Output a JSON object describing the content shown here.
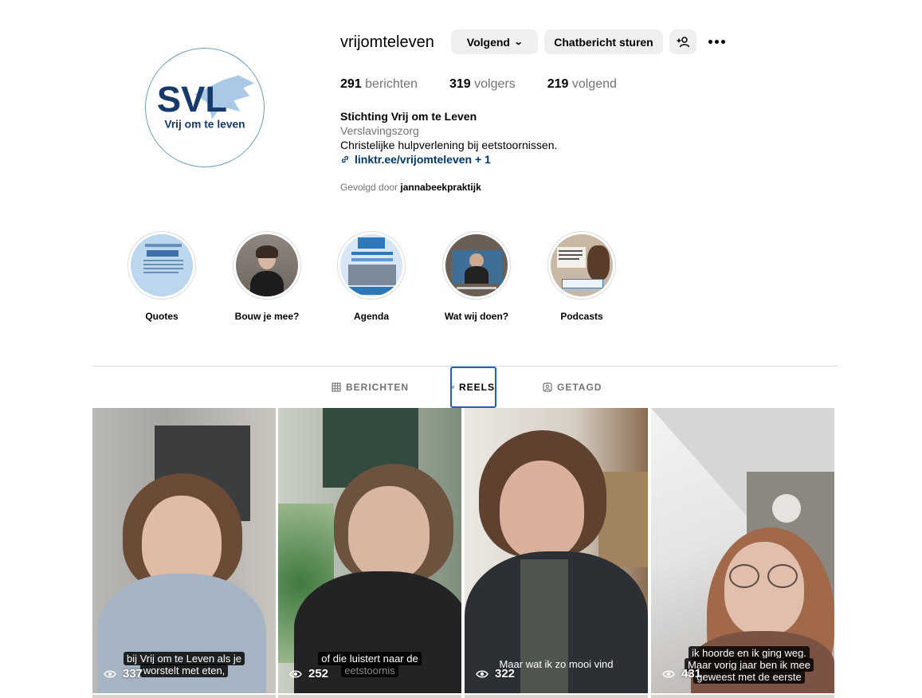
{
  "profile": {
    "username": "vrijomteleven",
    "follow_button": "Volgend",
    "message_button": "Chatbericht sturen",
    "avatar_logo": {
      "letters": "SVL",
      "tagline": "Vrij om te leven"
    },
    "stats": {
      "posts_count": "291",
      "posts_label": "berichten",
      "followers_count": "319",
      "followers_label": "volgers",
      "following_count": "219",
      "following_label": "volgend"
    },
    "bio": {
      "name": "Stichting Vrij om te Leven",
      "category": "Verslavingszorg",
      "text": "Christelijke hulpverlening bij eetstoornissen.",
      "link": "linktr.ee/vrijomteleven + 1"
    },
    "followed_by_prefix": "Gevolgd door",
    "followed_by_user": "jannabeekpraktijk"
  },
  "highlights": [
    {
      "label": "Quotes"
    },
    {
      "label": "Bouw je mee?"
    },
    {
      "label": "Agenda"
    },
    {
      "label": "Wat wij doen?"
    },
    {
      "label": "Podcasts"
    }
  ],
  "tabs": [
    {
      "label": "BERICHTEN",
      "active": false
    },
    {
      "label": "REELS",
      "active": true
    },
    {
      "label": "GETAGD",
      "active": false
    }
  ],
  "reels": [
    {
      "caption_line1": "bij Vrij om te Leven als je",
      "caption_line2": "worstelt met eten,",
      "views": "337"
    },
    {
      "caption_line1": "of die luistert naar de",
      "caption_line2": "eetstoornis",
      "views": "252"
    },
    {
      "caption_line1": "Maar wat ik zo mooi vind",
      "caption_line2": "",
      "views": "322"
    },
    {
      "caption_line1": "ik hoorde en ik ging weg.",
      "caption_line2": "Maar vorig jaar ben ik mee",
      "caption_line3": "geweest met de eerste",
      "views": "431"
    }
  ],
  "colors": {
    "link": "#00376b",
    "secondary_text": "#737373",
    "button_bg": "#efefef",
    "logo_navy": "#173a6b",
    "logo_lightblue": "#a9c9e6",
    "active_tab_outline": "#1d5fcf"
  }
}
